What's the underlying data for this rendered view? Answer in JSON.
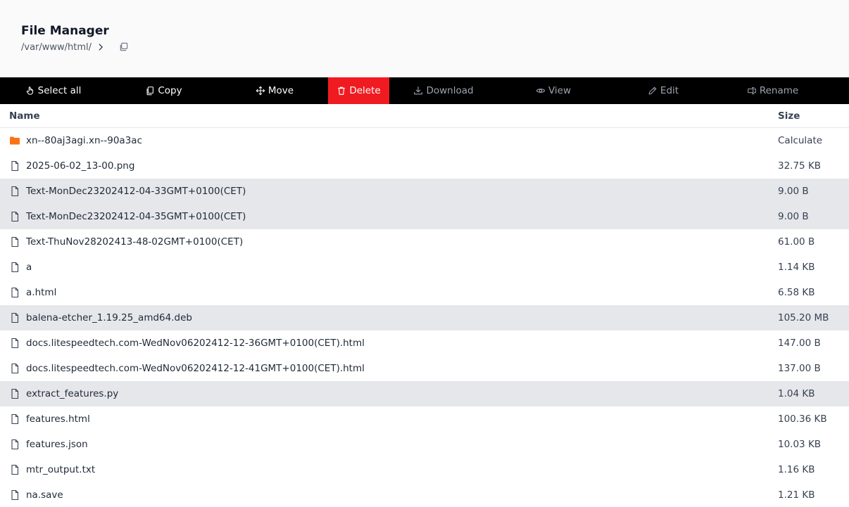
{
  "header": {
    "title": "File Manager",
    "path": "/var/www/html/"
  },
  "toolbar": {
    "select_all": "Select all",
    "copy": "Copy",
    "move": "Move",
    "delete": "Delete",
    "download": "Download",
    "view": "View",
    "edit": "Edit",
    "rename": "Rename"
  },
  "table": {
    "col_name": "Name",
    "col_size": "Size",
    "rows": [
      {
        "name": "xn--80aj3agi.xn--90a3ac",
        "size": "Calculate",
        "type": "folder",
        "selected": false
      },
      {
        "name": "2025-06-02_13-00.png",
        "size": "32.75 KB",
        "type": "file",
        "selected": false
      },
      {
        "name": "Text-MonDec23202412-04-33GMT+0100(CET)",
        "size": "9.00 B",
        "type": "file",
        "selected": true
      },
      {
        "name": "Text-MonDec23202412-04-35GMT+0100(CET)",
        "size": "9.00 B",
        "type": "file",
        "selected": true
      },
      {
        "name": "Text-ThuNov28202413-48-02GMT+0100(CET)",
        "size": "61.00 B",
        "type": "file",
        "selected": false
      },
      {
        "name": "a",
        "size": "1.14 KB",
        "type": "file",
        "selected": false
      },
      {
        "name": "a.html",
        "size": "6.58 KB",
        "type": "file",
        "selected": false
      },
      {
        "name": "balena-etcher_1.19.25_amd64.deb",
        "size": "105.20 MB",
        "type": "file",
        "selected": true
      },
      {
        "name": "docs.litespeedtech.com-WedNov06202412-12-36GMT+0100(CET).html",
        "size": "147.00 B",
        "type": "file",
        "selected": false
      },
      {
        "name": "docs.litespeedtech.com-WedNov06202412-12-41GMT+0100(CET).html",
        "size": "137.00 B",
        "type": "file",
        "selected": false
      },
      {
        "name": "extract_features.py",
        "size": "1.04 KB",
        "type": "file",
        "selected": true
      },
      {
        "name": "features.html",
        "size": "100.36 KB",
        "type": "file",
        "selected": false
      },
      {
        "name": "features.json",
        "size": "10.03 KB",
        "type": "file",
        "selected": false
      },
      {
        "name": "mtr_output.txt",
        "size": "1.16 KB",
        "type": "file",
        "selected": false
      },
      {
        "name": "na.save",
        "size": "1.21 KB",
        "type": "file",
        "selected": false
      }
    ]
  },
  "colors": {
    "toolbar_bg": "#000000",
    "delete_bg": "#ef1b21",
    "folder": "#f97316",
    "selected_row": "#e5e7eb"
  }
}
